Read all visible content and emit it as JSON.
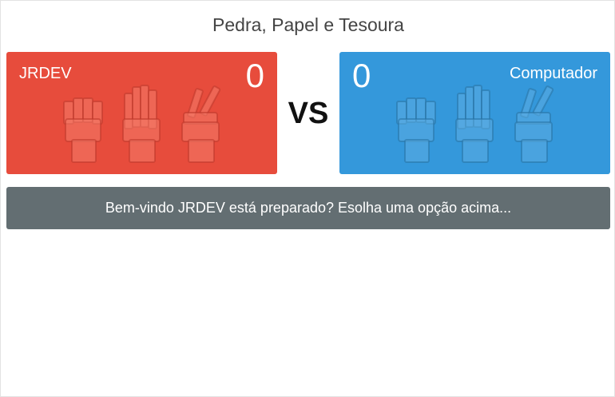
{
  "app": {
    "title": "Pedra, Papel e Tesoura"
  },
  "player": {
    "name": "JRDEV",
    "score": "0",
    "panel_color": "#e74c3c",
    "hand_color": "#f47c6a",
    "hand_outline": "#c0392b",
    "choices": [
      {
        "name": "pedra",
        "icon": "fist-icon"
      },
      {
        "name": "papel",
        "icon": "open-hand-icon"
      },
      {
        "name": "tesoura",
        "icon": "peace-hand-icon"
      }
    ]
  },
  "computer": {
    "name": "Computador",
    "score": "0",
    "panel_color": "#3498db",
    "hand_color": "#5dade2",
    "hand_outline": "#2874a6",
    "choices": [
      {
        "name": "pedra",
        "icon": "fist-icon"
      },
      {
        "name": "papel",
        "icon": "open-hand-icon"
      },
      {
        "name": "tesoura",
        "icon": "peace-hand-icon"
      }
    ]
  },
  "vs_label": "VS",
  "message": {
    "text": "Bem-vindo JRDEV está preparado? Esolha uma opção acima...",
    "color": "#636e72"
  }
}
